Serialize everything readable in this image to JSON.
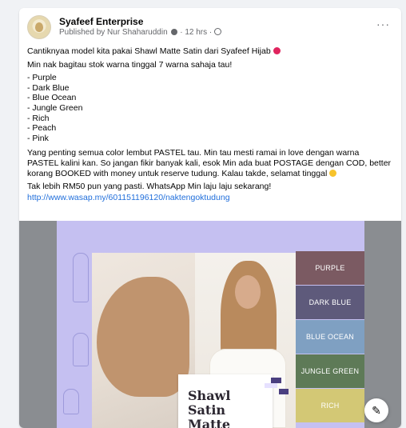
{
  "post": {
    "page_name": "Syafeef Enterprise",
    "meta_published": "Published by Nur Shaharuddin",
    "meta_time": "· 12 hrs ·",
    "more_label": "···"
  },
  "caption": {
    "line1": "Cantiknyaa model kita pakai Shawl Matte Satin dari Syafeef Hijab",
    "line2": "Min nak bagitau stok warna tinggal 7 warna sahaja tau!",
    "colors": [
      "- Purple",
      "- Dark Blue",
      "- Blue Ocean",
      "- Jungle Green",
      "- Rich",
      "- Peach",
      "- Pink"
    ],
    "paragraph": "Yang penting semua color lembut PASTEL tau. Min tau mesti ramai in love dengan warna PASTEL kalini kan. So jangan fikir banyak kali, esok Min ada buat POSTAGE dengan COD, better korang BOOKED with money untuk reserve tudung. Kalau takde, selamat tinggal",
    "cta": "Tak lebih RM50 pun yang pasti. WhatsApp Min laju laju sekarang!",
    "link": "http://www.wasap.my/601151196120/naktengoktudung"
  },
  "poster": {
    "title": "Shawl Satin Matte",
    "swatches": [
      {
        "label": "PURPLE",
        "color": "#7b5a62"
      },
      {
        "label": "DARK BLUE",
        "color": "#5e5a7b"
      },
      {
        "label": "BLUE OCEAN",
        "color": "#7fa0c2"
      },
      {
        "label": "JUNGLE GREEN",
        "color": "#5e7a57"
      },
      {
        "label": "RICH",
        "color": "#d3c875"
      }
    ]
  },
  "icons": {
    "more": "more-horizontal-icon",
    "edit": "edit-icon",
    "globe": "globe-icon"
  },
  "colors": {
    "link": "#216fdb",
    "poster_bg": "#c5c0f1"
  }
}
